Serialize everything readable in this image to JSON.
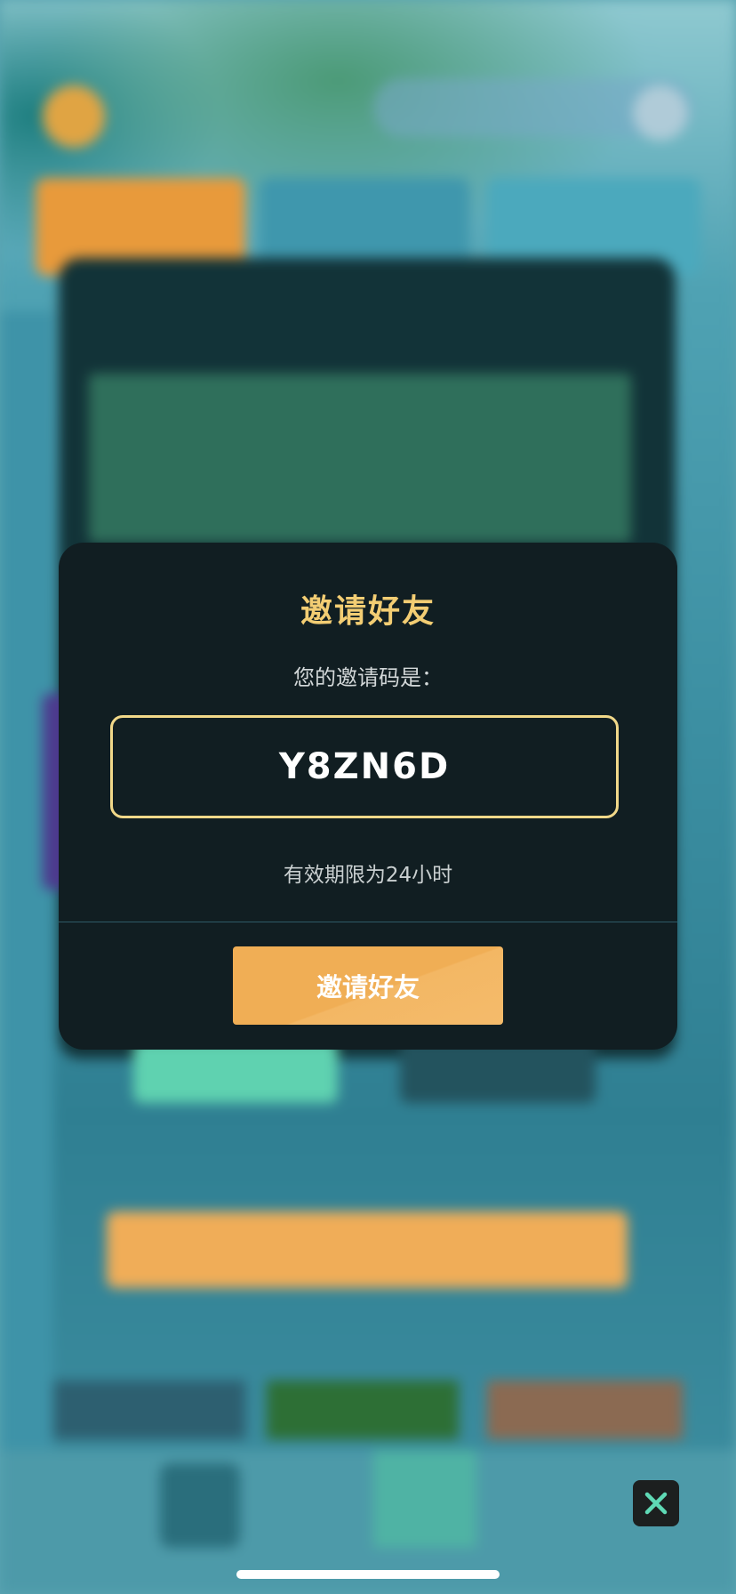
{
  "modal": {
    "title": "邀请好友",
    "subtitle": "您的邀请码是：",
    "invite_code": "Y8ZN6D",
    "validity_note": "有效期限为24小时",
    "button_label": "邀请好友"
  },
  "icons": {
    "close": "close-x-icon"
  },
  "colors": {
    "title": "#f3cd73",
    "code_border": "#f1d889",
    "button": "#f0ae55",
    "modal_bg": "#111e22",
    "close_icon": "#5fd9b5"
  }
}
